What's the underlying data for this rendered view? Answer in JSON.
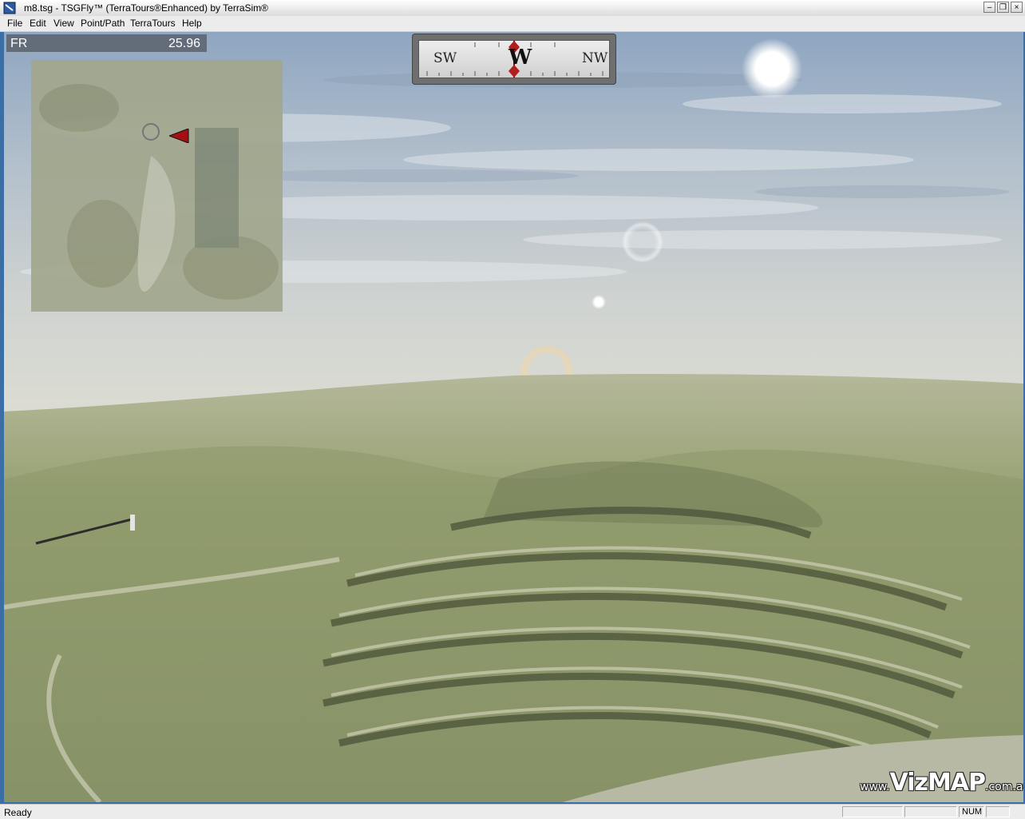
{
  "window": {
    "title": "m8.tsg - TSGFly™ (TerraTours®Enhanced) by TerraSim®",
    "icon": "app-icon",
    "controls": {
      "minimize": "minimize-icon",
      "restore": "restore-icon",
      "close": "close-icon"
    }
  },
  "menu": {
    "items": [
      {
        "label": "File"
      },
      {
        "label": "Edit"
      },
      {
        "label": "View"
      },
      {
        "label": "Point/Path"
      },
      {
        "label": "TerraTours"
      },
      {
        "label": "Help"
      }
    ]
  },
  "hud": {
    "framerate_label": "FR",
    "framerate_value": "25.96",
    "compass": {
      "left": "SW",
      "center": "W",
      "right": "NW"
    },
    "minimap_marker": "position-marker-icon"
  },
  "watermark": {
    "prefix": "www.",
    "brand": "VizMAP",
    "suffix": ".com.au"
  },
  "status": {
    "text": "Ready",
    "num_indicator": "NUM"
  },
  "colors": {
    "sky_top": "#8fa7c2",
    "horizon": "#dcdcd0",
    "terrain": "#8d9670",
    "marker": "#a00000"
  }
}
